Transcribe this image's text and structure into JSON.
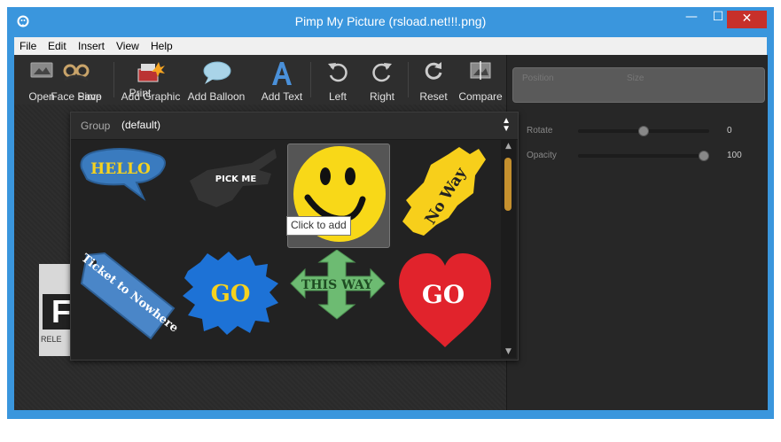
{
  "window": {
    "title": "Pimp My Picture (rsload.net!!!.png)",
    "minimize": "—",
    "maximize": "☐",
    "close": "✕"
  },
  "menu": [
    "File",
    "Edit",
    "Insert",
    "View",
    "Help"
  ],
  "toolbar": {
    "open": "Open",
    "face_pimp": "Face Pimp",
    "save": "Save",
    "add_graphic": "Add Graphic",
    "print": "Print",
    "add_balloon": "Add Balloon",
    "add_text": "Add Text",
    "left": "Left",
    "right": "Right",
    "reset": "Reset",
    "compare": "Compare"
  },
  "properties": {
    "position_label": "Position",
    "size_label": "Size",
    "rotate_label": "Rotate",
    "rotate_value": "0",
    "rotate_level": 0.5,
    "opacity_label": "Opacity",
    "opacity_value": "100",
    "opacity_level": 1.0
  },
  "canvas": {
    "image_letter": "F",
    "image_caption": "RELE"
  },
  "graphic_picker": {
    "group_label": "Group",
    "group_value": "(default)",
    "tooltip": "Click to add",
    "stickers": [
      {
        "name": "hello-balloon",
        "text": "HELLO"
      },
      {
        "name": "pick-me-hand",
        "text": "PICK ME"
      },
      {
        "name": "smiley-face",
        "text": ""
      },
      {
        "name": "no-way-sign",
        "text": "No Way"
      },
      {
        "name": "ticket-to-nowhere-tag",
        "text": "Ticket to Nowhere"
      },
      {
        "name": "go-burst",
        "text": "GO"
      },
      {
        "name": "this-way-arrows",
        "text": "THIS WAY"
      },
      {
        "name": "go-heart",
        "text": "GO"
      }
    ]
  },
  "colors": {
    "title_bar": "#3a96dd",
    "close_button": "#c7302a",
    "scroll_thumb": "#c5902e",
    "hello_blue": "#3a7bbf",
    "hello_text": "#f5d21f",
    "smiley_yellow": "#f8d818",
    "no_way_yellow": "#f7cf1b",
    "ticket_blue": "#4a86c8",
    "go_burst_blue": "#1d72d6",
    "this_way_green": "#6dbb72",
    "heart_red": "#e1232c"
  }
}
